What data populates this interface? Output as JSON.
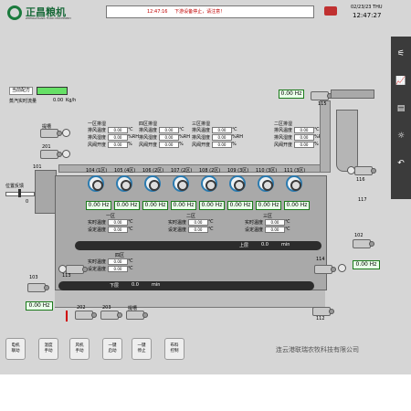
{
  "header": {
    "logo_text": "正昌粮机",
    "logo_subtext": "ZHENGCHANG FOOD MACHINERY",
    "alarm_time": "12:47:16",
    "alarm_msg": "下游设备停止，请注意！",
    "date": "02/23/23 THU",
    "time": "12:47:27"
  },
  "left_panel": {
    "formula_label": "当前配方",
    "steam_label": "蒸汽实时流量",
    "steam_value": "0.00",
    "steam_unit": "Kg/h",
    "position_label": "位置反馈",
    "pos_value": "0",
    "hz_unit": "Hz",
    "bottom_value": "0.00"
  },
  "devices": {
    "d101": "101",
    "d102": "102",
    "d103": "103",
    "d113": "113",
    "d114": "114",
    "d115": "115",
    "d116": "116",
    "d117": "117",
    "d201": "201",
    "d112": "112",
    "d202": "202",
    "d203": "203",
    "trough": "提槽",
    "hopper": "提槽"
  },
  "top_values": {
    "right_hz": "0.00",
    "m102_hz": "0.00",
    "bottom_hz_103": "0.00"
  },
  "zones": [
    {
      "title": "一区排湿",
      "rows": [
        [
          "排风温度",
          "0.00",
          "℃"
        ],
        [
          "排风湿度",
          "0.00",
          "%RH"
        ],
        [
          "风阀开度",
          "0.00",
          "%"
        ]
      ]
    },
    {
      "title": "四区排湿",
      "rows": [
        [
          "排风温度",
          "0.00",
          "℃"
        ],
        [
          "排风湿度",
          "0.00",
          "%RH"
        ],
        [
          "风阀开度",
          "0.00",
          "%"
        ]
      ]
    },
    {
      "title": "三区排湿",
      "rows": [
        [
          "排风温度",
          "0.00",
          "℃"
        ],
        [
          "排风湿度",
          "0.00",
          "%RH"
        ],
        [
          "风阀开度",
          "0.00",
          "%"
        ]
      ]
    },
    {
      "title": "二区排湿",
      "rows": [
        [
          "排风温度",
          "0.00",
          "℃"
        ],
        [
          "排风湿度",
          "0.00",
          "%RH"
        ],
        [
          "风阀开度",
          "0.00",
          "%"
        ]
      ]
    }
  ],
  "fans": [
    {
      "label": "104 (1区)",
      "value": "0.00",
      "unit": "Hz"
    },
    {
      "label": "105 (4区)",
      "value": "0.00",
      "unit": "Hz"
    },
    {
      "label": "106 (2区)",
      "value": "0.00",
      "unit": "Hz"
    },
    {
      "label": "107 (2区)",
      "value": "0.00",
      "unit": "Hz"
    },
    {
      "label": "108 (2区)",
      "value": "0.00",
      "unit": "Hz"
    },
    {
      "label": "109 (3区)",
      "value": "0.00",
      "unit": "Hz"
    },
    {
      "label": "110 (3区)",
      "value": "0.00",
      "unit": "Hz"
    },
    {
      "label": "111 (3区)",
      "value": "0.00",
      "unit": "Hz"
    }
  ],
  "temp_zones": [
    {
      "title": "一区",
      "rows": [
        [
          "实时温度",
          "0.00",
          "℃"
        ],
        [
          "设定温度",
          "0.00",
          "℃"
        ]
      ]
    },
    {
      "title": "二区",
      "rows": [
        [
          "实时温度",
          "0.00",
          "℃"
        ],
        [
          "设定温度",
          "0.00",
          "℃"
        ]
      ]
    },
    {
      "title": "三区",
      "rows": [
        [
          "实时温度",
          "0.00",
          "℃"
        ],
        [
          "设定温度",
          "0.00",
          "℃"
        ]
      ]
    },
    {
      "title": "四区",
      "rows": [
        [
          "实时温度",
          "0.00",
          "℃"
        ],
        [
          "设定温度",
          "0.00",
          "℃"
        ]
      ]
    }
  ],
  "conveyors": {
    "upper_label": "上层",
    "upper_value": "0.0",
    "lower_label": "下层",
    "lower_value": "0.0",
    "unit": "min"
  },
  "buttons": [
    {
      "line1": "电机",
      "line2": "联动"
    },
    {
      "line1": "温度",
      "line2": "手动"
    },
    {
      "line1": "风机",
      "line2": "手动"
    },
    {
      "line1": "一键",
      "line2": "启动"
    },
    {
      "line1": "一键",
      "line2": "停止"
    },
    {
      "line1": "布料",
      "line2": "控制"
    }
  ],
  "company": "连云港联瑞农牧科技有限公司",
  "colors": {
    "accent_blue": "#2b7bb0",
    "alarm_red": "#c00000",
    "value_green": "#1b7a1b"
  }
}
